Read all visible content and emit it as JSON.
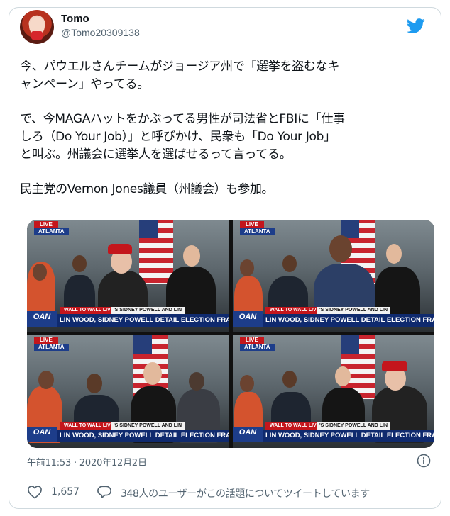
{
  "author": {
    "display_name": "Tomo",
    "handle": "@Tomo20309138"
  },
  "tweet": {
    "paragraphs": [
      [
        "今、パウエルさんチームがジョージア州で「選挙を盗むなキ",
        "ャンペーン」やってる。"
      ],
      [
        "で、今MAGAハットをかぶってる男性が司法省とFBIに「仕事",
        "しろ（Do Your Job）」と呼びかけ、民衆も「Do Your Job」",
        "と叫ぶ。州議会に選挙人を選ばせるって言ってる。"
      ],
      [
        "民主党のVernon Jones議員（州議会）も参加。"
      ]
    ],
    "timestamp": "午前11:53 · 2020年12月2日"
  },
  "media": {
    "live_label": "LIVE",
    "location": "ATLANTA",
    "wall_label": "WALL TO WALL LIVE",
    "wall_sub": "'S SIDNEY POWELL AND LIN",
    "network": "OAN",
    "headline": "LIN WOOD, SIDNEY POWELL DETAIL ELECTION FRAUD IN GA"
  },
  "stats": {
    "likes": "1,657",
    "reply_text": "348人のユーザーがこの話題についてツイートしています"
  },
  "colors": {
    "text": "#0f1419",
    "muted": "#536471",
    "twitter_blue": "#1d9bf0",
    "oan_blue": "#0f2a6e",
    "live_red": "#c4161c"
  },
  "icons": [
    "twitter-bird-icon",
    "info-icon",
    "heart-icon",
    "reply-bubble-icon"
  ]
}
